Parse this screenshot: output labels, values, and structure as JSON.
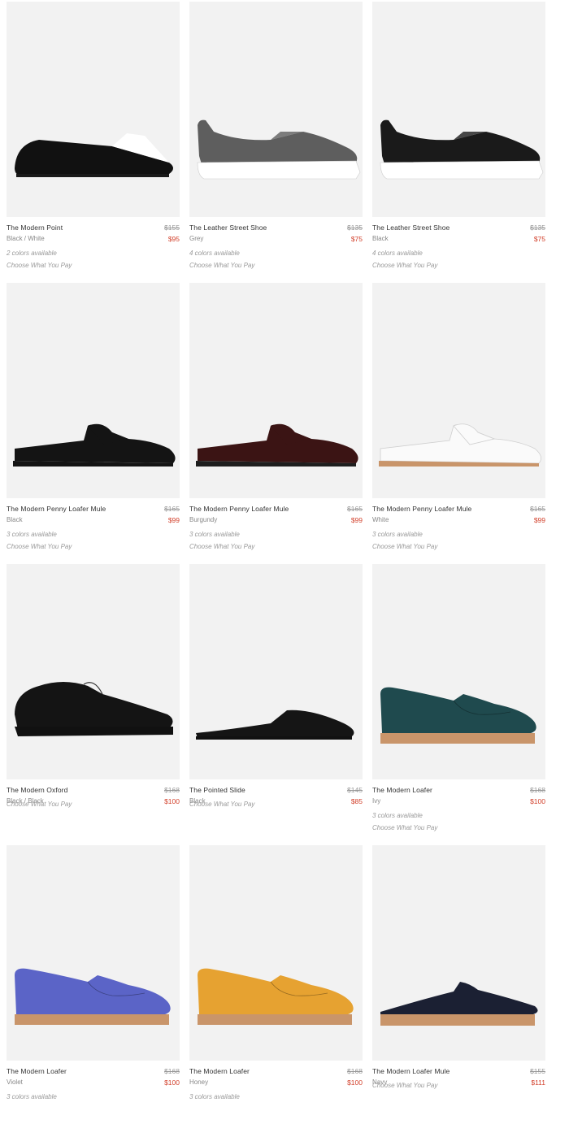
{
  "products": [
    {
      "name": "The Modern Point",
      "color": "Black / White",
      "original_price": "$155",
      "sale_price": "$95",
      "colors_available": "2 colors available",
      "choose_label": "Choose What You Pay",
      "shoe_style": "point",
      "shoe_color": "#111111",
      "accent_color": "#ffffff",
      "sole_color": "#1a1a1a"
    },
    {
      "name": "The Leather Street Shoe",
      "color": "Grey",
      "original_price": "$135",
      "sale_price": "$75",
      "colors_available": "4 colors available",
      "choose_label": "Choose What You Pay",
      "shoe_style": "street",
      "shoe_color": "#5e5e5e",
      "accent_color": "#5e5e5e",
      "sole_color": "#ffffff"
    },
    {
      "name": "The Leather Street Shoe",
      "color": "Black",
      "original_price": "$135",
      "sale_price": "$75",
      "colors_available": "4 colors available",
      "choose_label": "Choose What You Pay",
      "shoe_style": "street",
      "shoe_color": "#1a1a1a",
      "accent_color": "#1a1a1a",
      "sole_color": "#ffffff"
    },
    {
      "name": "The Modern Penny Loafer Mule",
      "color": "Black",
      "original_price": "$165",
      "sale_price": "$99",
      "colors_available": "3 colors available",
      "choose_label": "Choose What You Pay",
      "shoe_style": "mule",
      "shoe_color": "#141414",
      "accent_color": "#141414",
      "sole_color": "#141414"
    },
    {
      "name": "The Modern Penny Loafer Mule",
      "color": "Burgundy",
      "original_price": "$165",
      "sale_price": "$99",
      "colors_available": "3 colors available",
      "choose_label": "Choose What You Pay",
      "shoe_style": "mule",
      "shoe_color": "#3b1414",
      "accent_color": "#3b1414",
      "sole_color": "#1e1e1e"
    },
    {
      "name": "The Modern Penny Loafer Mule",
      "color": "White",
      "original_price": "$165",
      "sale_price": "$99",
      "colors_available": "3 colors available",
      "choose_label": "Choose What You Pay",
      "shoe_style": "mule",
      "shoe_color": "#fafafa",
      "accent_color": "#fafafa",
      "sole_color": "#c9956a"
    },
    {
      "name": "The Modern Oxford",
      "color": "Black / Black",
      "original_price": "$168",
      "sale_price": "$100",
      "colors_available": "",
      "choose_label": "Choose What You Pay",
      "shoe_style": "oxford",
      "shoe_color": "#141414",
      "accent_color": "#141414",
      "sole_color": "#111111"
    },
    {
      "name": "The Pointed Slide",
      "color": "Black",
      "original_price": "$145",
      "sale_price": "$85",
      "colors_available": "",
      "choose_label": "Choose What You Pay",
      "shoe_style": "slide",
      "shoe_color": "#151515",
      "accent_color": "#151515",
      "sole_color": "#151515"
    },
    {
      "name": "The Modern Loafer",
      "color": "Ivy",
      "original_price": "$168",
      "sale_price": "$100",
      "colors_available": "3 colors available",
      "choose_label": "Choose What You Pay",
      "shoe_style": "loafer",
      "shoe_color": "#1f4a4e",
      "accent_color": "#1f4a4e",
      "sole_color": "#c9956a"
    },
    {
      "name": "The Modern Loafer",
      "color": "Violet",
      "original_price": "$168",
      "sale_price": "$100",
      "colors_available": "3 colors available",
      "choose_label": "",
      "shoe_style": "loafer",
      "shoe_color": "#5b64c7",
      "accent_color": "#5b64c7",
      "sole_color": "#c9956a"
    },
    {
      "name": "The Modern Loafer",
      "color": "Honey",
      "original_price": "$168",
      "sale_price": "$100",
      "colors_available": "3 colors available",
      "choose_label": "",
      "shoe_style": "loafer",
      "shoe_color": "#e6a231",
      "accent_color": "#e6a231",
      "sole_color": "#c9956a"
    },
    {
      "name": "The Modern Loafer Mule",
      "color": "Navy",
      "original_price": "$155",
      "sale_price": "$111",
      "colors_available": "",
      "choose_label": "Choose What You Pay",
      "shoe_style": "loafermule",
      "shoe_color": "#1b2033",
      "accent_color": "#1b2033",
      "sole_color": "#c9956a"
    }
  ]
}
